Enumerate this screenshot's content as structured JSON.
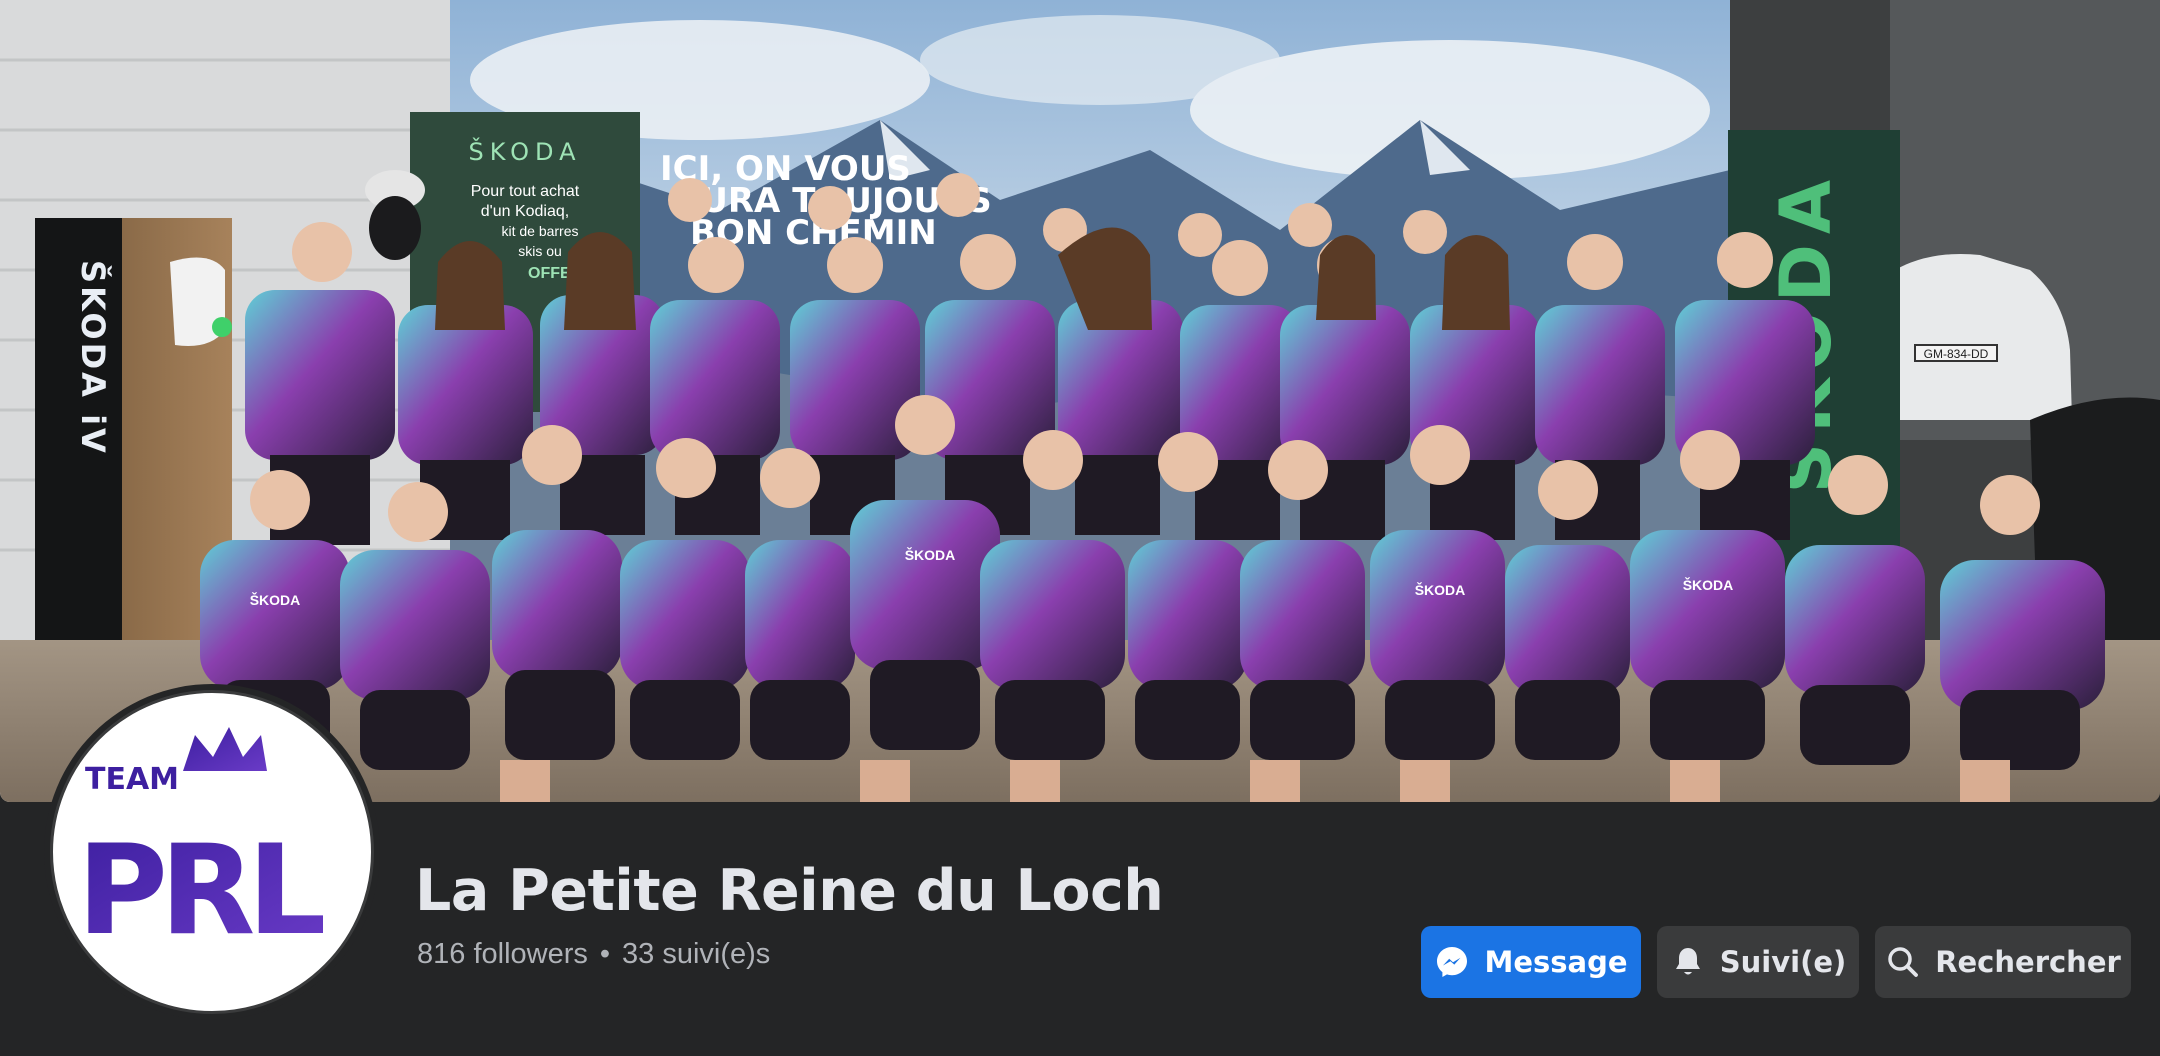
{
  "cover": {
    "banner_left_brand": "ŠKODA",
    "banner_left_text": [
      "Pour tout achat",
      "d'un Kodiaq,",
      "kit de barres",
      "skis ou",
      "OFFERT"
    ],
    "backdrop_slogan": [
      "ICI, ON VOUS",
      "AURA TOUJOURS",
      "BON CHEMIN"
    ],
    "pillar_text": "ŠKODA iV",
    "banner_right_brand": "ŠKODA",
    "license_plate": "GM-834-DD",
    "jersey_text": "ŠKODA"
  },
  "avatar": {
    "logo_top": "TEAM",
    "logo_main": "PRL"
  },
  "page": {
    "title": "La Petite Reine du Loch",
    "followers": "816 followers",
    "separator": "•",
    "following": "33 suivi(e)s"
  },
  "actions": {
    "message_label": "Message",
    "follow_label": "Suivi(e)",
    "search_label": "Rechercher"
  },
  "colors": {
    "background": "#242526",
    "primary_button": "#1b74e4",
    "secondary_button": "#3a3b3c",
    "text_primary": "#e4e6eb",
    "text_secondary": "#b0b3b8",
    "logo_purple": "#4b2aa6"
  },
  "icons": {
    "message": "messenger-icon",
    "follow": "bell-icon",
    "search": "search-icon"
  }
}
